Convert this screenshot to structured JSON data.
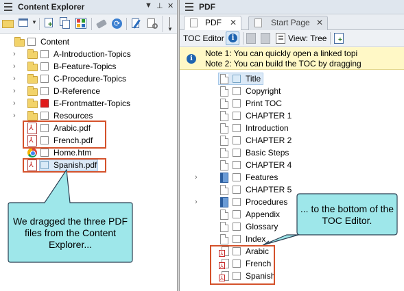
{
  "left_panel": {
    "title": "Content Explorer",
    "header_controls": [
      "▼",
      "⊥",
      "✕"
    ],
    "tree": {
      "root": "Content",
      "folders": [
        "A-Introduction-Topics",
        "B-Feature-Topics",
        "C-Procedure-Topics",
        "D-Reference",
        "E-Frontmatter-Topics",
        "Resources"
      ],
      "files": [
        "Arabic.pdf",
        "French.pdf",
        "Home.htm",
        "Spanish.pdf"
      ]
    },
    "callout": "We dragged the three PDF files from the Content Explorer..."
  },
  "right_panel": {
    "title": "PDF",
    "tabs": [
      {
        "label": "PDF",
        "close": "✕",
        "active": true
      },
      {
        "label": "Start Page",
        "close": "✕",
        "active": false
      }
    ],
    "toolbar": {
      "toc_editor": "TOC Editor",
      "view_label": "View: Tree"
    },
    "notes": [
      "Note 1: You can quickly open a linked topi",
      "Note 2: You can build the TOC by dragging"
    ],
    "toc_items": [
      "Title",
      "Copyright",
      "Print TOC",
      "CHAPTER 1",
      "Introduction",
      "CHAPTER 2",
      "Basic Steps",
      "CHAPTER 4",
      "Features",
      "CHAPTER 5",
      "Procedures",
      "Appendix",
      "Glossary",
      "Index",
      "Arabic",
      "French",
      "Spanish"
    ],
    "callout": "... to the bottom of the TOC Editor."
  },
  "colors": {
    "highlight_box": "#d4512a",
    "callout_fill": "#9ee7ea",
    "notes_bg": "#fff8c6",
    "header_bg": "#dfe6ee"
  }
}
